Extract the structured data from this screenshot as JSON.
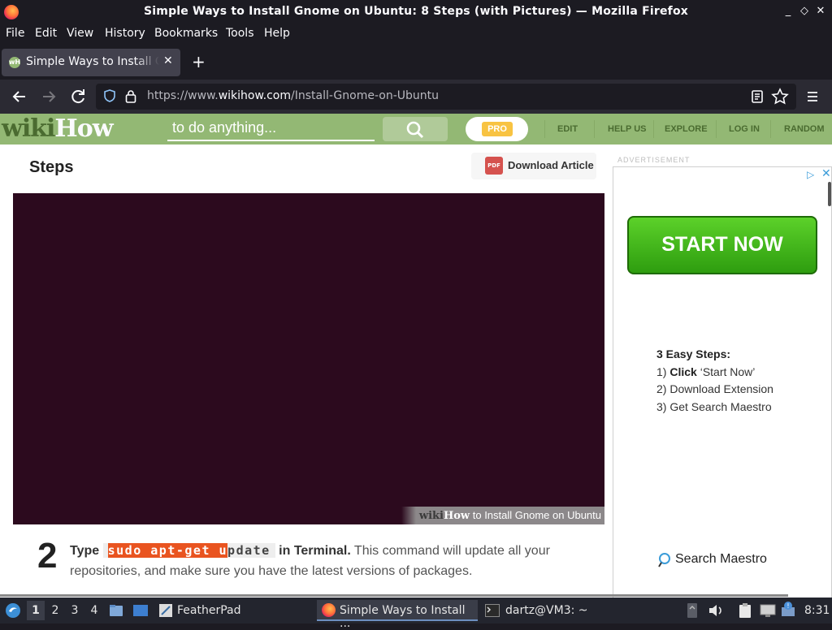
{
  "window": {
    "title": "Simple Ways to Install Gnome on Ubuntu: 8 Steps (with Pictures) — Mozilla Firefox",
    "controls": [
      "_",
      "◇",
      "✕"
    ]
  },
  "menu": [
    "File",
    "Edit",
    "View",
    "History",
    "Bookmarks",
    "Tools",
    "Help"
  ],
  "tab": {
    "title": "Simple Ways to Install Gnome on Ubuntu",
    "close": "✕",
    "new_tab": "+"
  },
  "nav": {
    "url_prefix": "https://www.",
    "url_domain": "wikihow.com",
    "url_path": "/Install-Gnome-on-Ubuntu"
  },
  "wikihow": {
    "logo_wiki": "wiki",
    "logo_how": "How",
    "search_placeholder": "to do anything...",
    "pro": "PRO",
    "nav_items": [
      "EDIT",
      "HELP US",
      "EXPLORE",
      "LOG IN",
      "RANDOM"
    ]
  },
  "article": {
    "section_title": "Steps",
    "download_label": "Download Article",
    "pdf_badge": "PDF",
    "watermark_wiki": "wiki",
    "watermark_how": "How",
    "watermark_text": " to Install Gnome on Ubuntu",
    "step_number": "2",
    "step_lead_1": "Type ",
    "step_code_hl": "sudo apt-get u",
    "step_code_rest": "pdate",
    "step_lead_2": " in Terminal.",
    "step_body": " This command will update all your repositories, and make sure you have the latest versions of packages."
  },
  "ad": {
    "label": "ADVERTISEMENT",
    "cta": "START NOW",
    "steps_title": "3 Easy Steps:",
    "step1_num": "1) ",
    "step1_bold": "Click",
    "step1_rest": " ‘Start Now’",
    "step2": "2) Download Extension",
    "step3": "3) Get Search Maestro",
    "brand": "Search Maestro"
  },
  "taskbar": {
    "workspaces": [
      "1",
      "2",
      "3",
      "4"
    ],
    "featherpad": "FeatherPad",
    "firefox_task": "Simple Ways to Install ...",
    "terminal_task": "dartz@VM3: ~",
    "clock": "8:31"
  },
  "colors": {
    "wikihow_green": "#93b874",
    "video_bg": "#2c0a1e",
    "ubuntu_orange": "#e95420",
    "ad_button": "#3aa81a"
  }
}
